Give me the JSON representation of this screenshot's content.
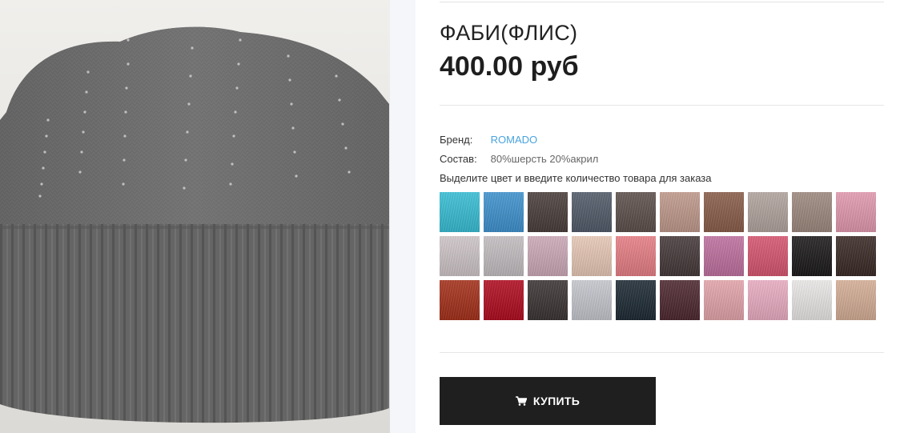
{
  "product": {
    "title": "ФАБИ(ФЛИС)",
    "price": "400.00 руб",
    "image_alt": "beanie-photo"
  },
  "attributes": {
    "brand_label": "Бренд:",
    "brand_value": "ROMADO",
    "composition_label": "Состав:",
    "composition_value": "80%шерсть 20%акрил"
  },
  "instruction": "Выделите цвет и введите количество товара для заказа",
  "swatches": [
    "#38bfd6",
    "#3f93cf",
    "#4a3e3a",
    "#525b6a",
    "#5e504c",
    "#c19a8c",
    "#8a5d4a",
    "#b3a59f",
    "#9e8a7f",
    "#e39ab0",
    "#cfc6c8",
    "#c4bfc2",
    "#cdaab8",
    "#e8c9b6",
    "#e77f85",
    "#46393a",
    "#c071a0",
    "#d85670",
    "#1c1a1a",
    "#3a2a26",
    "#a5301a",
    "#b10c20",
    "#3b3534",
    "#c6c8cf",
    "#1d2a34",
    "#4e2830",
    "#e5a6ac",
    "#eaaec3",
    "#ebe9e8",
    "#d6af97"
  ],
  "buy_button": {
    "label": "КУПИТЬ",
    "icon": "cart-icon"
  },
  "colors": {
    "accent_link": "#4aa3df",
    "button_bg": "#1f1f1f"
  }
}
